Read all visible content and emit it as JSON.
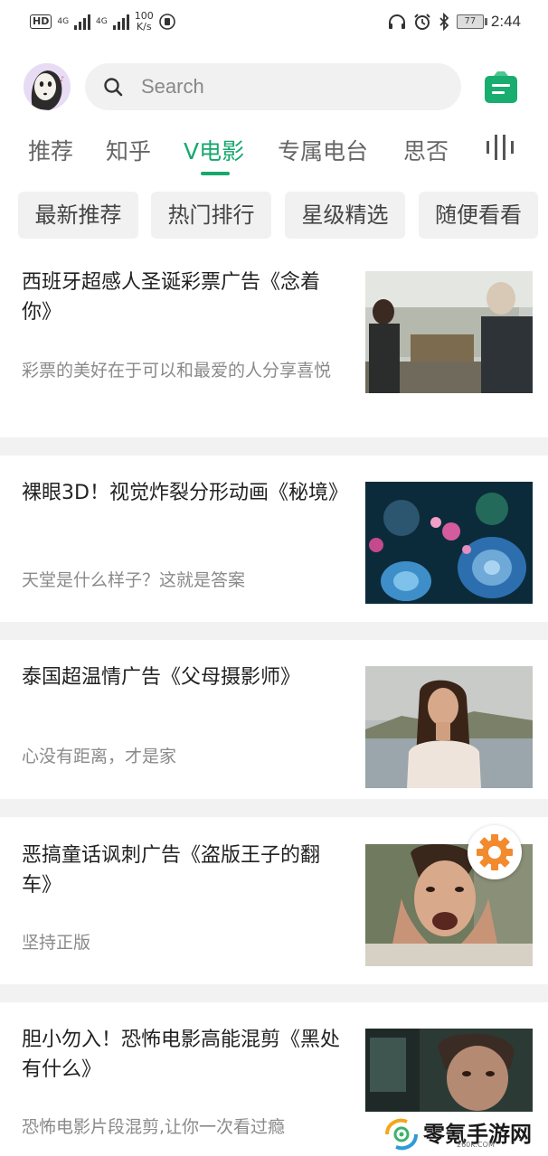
{
  "status_bar": {
    "hd": "HD",
    "net1": "4G",
    "net2": "4G",
    "speed_value": "100",
    "speed_unit": "K/s",
    "battery": "77",
    "time": "2:44"
  },
  "header": {
    "search_placeholder": "Search"
  },
  "tabs": [
    {
      "label": "推荐"
    },
    {
      "label": "知乎"
    },
    {
      "label": "V电影"
    },
    {
      "label": "专属电台"
    },
    {
      "label": "思否"
    }
  ],
  "active_tab": "V电影",
  "chips": [
    {
      "label": "最新推荐"
    },
    {
      "label": "热门排行"
    },
    {
      "label": "星级精选"
    },
    {
      "label": "随便看看"
    }
  ],
  "feed": [
    {
      "title": "西班牙超感人圣诞彩票广告《念着你》",
      "subtitle": "彩票的美好在于可以和最爱的人分享喜悦"
    },
    {
      "title": "裸眼3D！视觉炸裂分形动画《秘境》",
      "subtitle": "天堂是什么样子？这就是答案"
    },
    {
      "title": "泰国超温情广告《父母摄影师》",
      "subtitle": "心没有距离，才是家"
    },
    {
      "title": "恶搞童话讽刺广告《盗版王子的翻车》",
      "subtitle": "坚持正版"
    },
    {
      "title": "胆小勿入！恐怖电影高能混剪《黑处有什么》",
      "subtitle": "恐怖电影片段混剪,让你一次看过瘾"
    }
  ],
  "watermark": {
    "name": "零氪手游网",
    "domain": "260K.COM"
  },
  "colors": {
    "accent": "#17a86e",
    "chip_bg": "#f1f1f1",
    "divider": "#f2f2f2",
    "gear": "#f28a2e"
  }
}
